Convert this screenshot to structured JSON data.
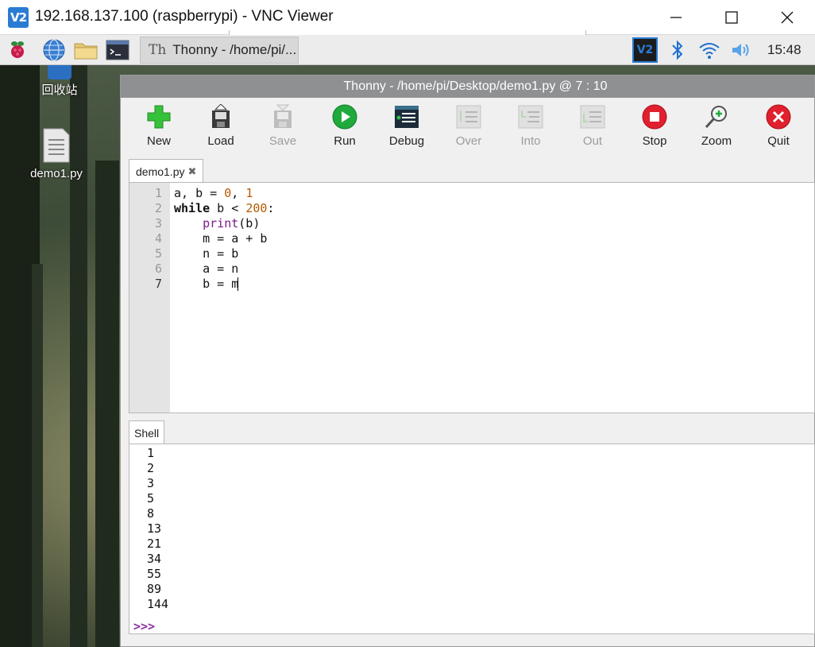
{
  "vnc": {
    "logo": "V2",
    "title": "192.168.137.100 (raspberrypi) - VNC Viewer"
  },
  "panel": {
    "taskbar_app_icon": "Th",
    "taskbar_app_label": "Thonny  -  /home/pi/...",
    "tray_vnc": "V2",
    "clock": "15:48",
    "icons": [
      "raspberry-menu-icon",
      "globe-icon",
      "folder-icon",
      "terminal-icon",
      "bluetooth-icon",
      "wifi-icon",
      "volume-icon"
    ]
  },
  "desktop": {
    "icons": [
      {
        "label": "回收站",
        "icon": "trash-icon"
      },
      {
        "label": "demo1.py",
        "icon": "text-file-icon"
      }
    ]
  },
  "thonny": {
    "title": "Thonny  -  /home/pi/Desktop/demo1.py  @  7 : 10",
    "toolbar": [
      {
        "label": "New",
        "icon": "new-icon",
        "enabled": true
      },
      {
        "label": "Load",
        "icon": "load-icon",
        "enabled": true
      },
      {
        "label": "Save",
        "icon": "save-icon",
        "enabled": false
      },
      {
        "label": "Run",
        "icon": "run-icon",
        "enabled": true
      },
      {
        "label": "Debug",
        "icon": "debug-icon",
        "enabled": true
      },
      {
        "label": "Over",
        "icon": "step-over-icon",
        "enabled": false
      },
      {
        "label": "Into",
        "icon": "step-into-icon",
        "enabled": false
      },
      {
        "label": "Out",
        "icon": "step-out-icon",
        "enabled": false
      },
      {
        "label": "Stop",
        "icon": "stop-icon",
        "enabled": true
      },
      {
        "label": "Zoom",
        "icon": "zoom-icon",
        "enabled": true
      },
      {
        "label": "Quit",
        "icon": "quit-icon",
        "enabled": true
      }
    ],
    "editor_tab": "demo1.py",
    "editor_tab_close": "✖",
    "line_numbers": [
      "1",
      "2",
      "3",
      "4",
      "5",
      "6",
      "7"
    ],
    "code_lines": [
      "a, b = 0, 1",
      "while b < 200:",
      "    print(b)",
      "    m = a + b",
      "    n = b",
      "    a = n",
      "    b = m"
    ],
    "shell_tab": "Shell",
    "shell_output": [
      "1",
      "2",
      "3",
      "5",
      "8",
      "13",
      "21",
      "34",
      "55",
      "89",
      "144"
    ],
    "shell_prompt": ">>>"
  },
  "colors": {
    "thonny_titlebar": "#8e9092",
    "number_literal": "#b35a00",
    "builtin": "#7a1a8a",
    "prompt": "#8b2fa0",
    "vnc_accent": "#2a7bd4"
  }
}
